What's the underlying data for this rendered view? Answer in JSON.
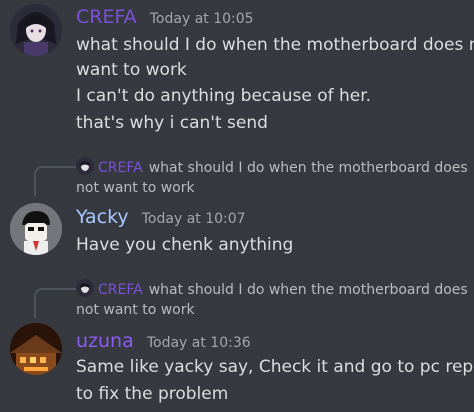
{
  "colors": {
    "background": "#36393f",
    "crefa": "#7b51d8",
    "yacky": "#a7c8ff",
    "uzuna": "#8b5cf0"
  },
  "messages": [
    {
      "author": "CREFA",
      "timestamp": "Today at 10:05",
      "lines": [
        "what should I do when the motherboard does not",
        "want to work",
        "I can't do anything because of her.",
        "that's why i can't send"
      ]
    },
    {
      "reply_to": {
        "author": "CREFA",
        "text_line1": "what should I do when the motherboard does",
        "text_line2": "not want to work"
      },
      "author": "Yacky",
      "timestamp": "Today at 10:07",
      "lines": [
        "Have you chenk anything"
      ]
    },
    {
      "reply_to": {
        "author": "CREFA",
        "text_line1": "what should I do when the motherboard does",
        "text_line2": "not want to work"
      },
      "author": "uzuna",
      "timestamp": "Today at 10:36",
      "lines": [
        "Same like yacky say, Check it and go to pc repair",
        "to fix the problem"
      ]
    }
  ]
}
